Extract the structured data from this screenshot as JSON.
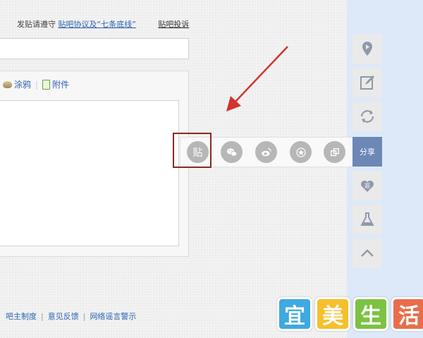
{
  "notice": {
    "prefix": "发贴请遵守",
    "agreement_link": "贴吧协议及“七条底线”",
    "report_link": "贴吧投诉"
  },
  "toolbar": {
    "graffiti_label": "涂鸦",
    "attachment_label": "附件"
  },
  "share_bar": {
    "tieba_label": "贴",
    "buttons": [
      "tieba-share",
      "wechat-share",
      "weibo-share",
      "favorite-share",
      "copy-link-share"
    ]
  },
  "sidebar": {
    "items": [
      "location-icon",
      "edit-icon",
      "refresh-icon"
    ],
    "share_label": "分享",
    "items_below": [
      "heart-icon",
      "flask-icon",
      "back-to-top-icon"
    ],
    "heart_text": "逛"
  },
  "footer": {
    "links": [
      "吧主制度",
      "意见反馈",
      "网络谣言警示"
    ]
  },
  "watermark": {
    "chars": [
      "宜",
      "美",
      "生",
      "活"
    ]
  },
  "colors": {
    "accent_blue": "#2d64b3",
    "share_active": "#6d87b6",
    "highlight_border": "#8a2a24",
    "arrow_red": "#d3342c"
  }
}
